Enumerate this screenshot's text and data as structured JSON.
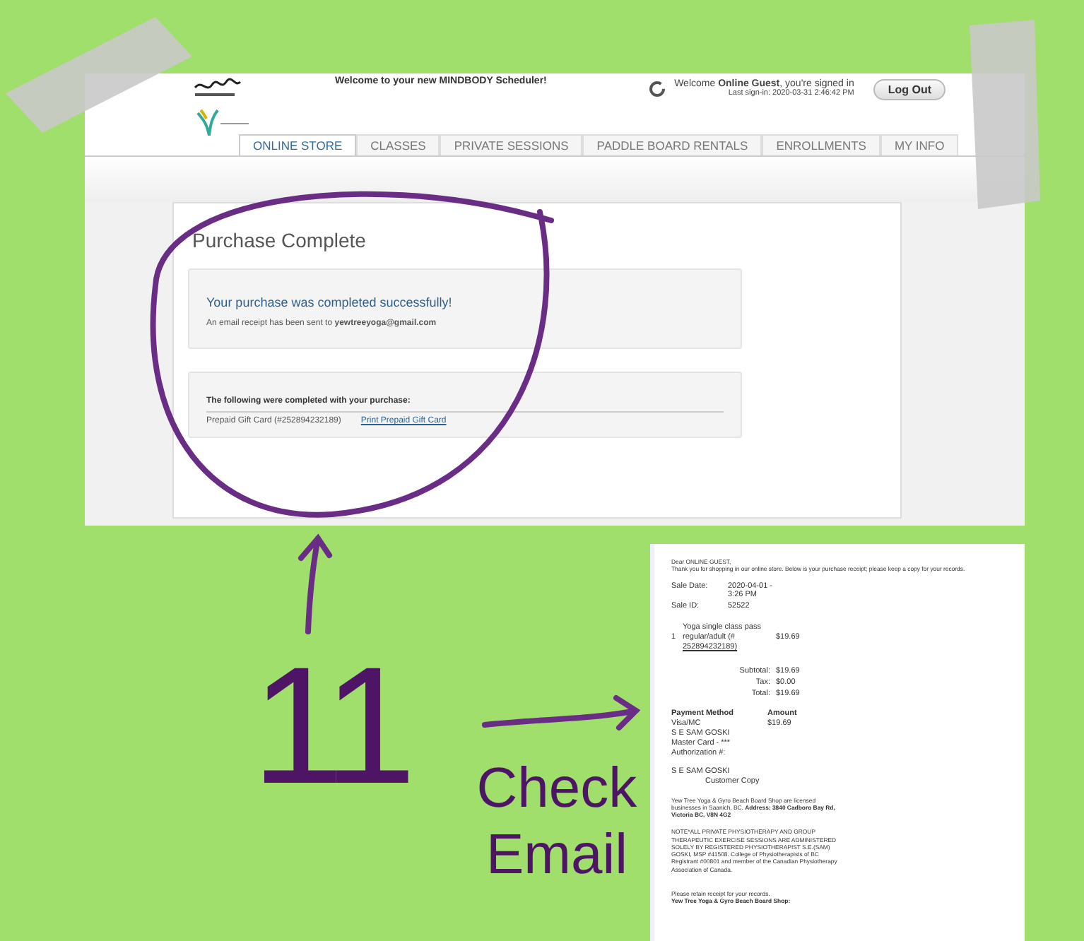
{
  "header": {
    "welcome_banner": "Welcome to your new MINDBODY Scheduler!",
    "greeting": "Welcome **Online Guest**, you're signed in",
    "last_signin": "Last sign-in: 2020-03-31 2:46:42 PM",
    "logout": "Log Out"
  },
  "tabs": [
    {
      "label": "ONLINE STORE",
      "selected": true
    },
    {
      "label": "CLASSES",
      "selected": false
    },
    {
      "label": "PRIVATE SESSIONS",
      "selected": false
    },
    {
      "label": "PADDLE BOARD RENTALS",
      "selected": false
    },
    {
      "label": "ENROLLMENTS",
      "selected": false
    },
    {
      "label": "MY INFO",
      "selected": false
    }
  ],
  "purchase": {
    "title": "Purchase Complete",
    "success": "Your purchase was completed successfully!",
    "receipt_note": "An email receipt has been sent to **yewtreeyoga@gmail.com**",
    "completed_heading": "The following were completed with your purchase:",
    "item": "Prepaid Gift Card (#252894232189)",
    "item_link": "Print Prepaid Gift Card"
  },
  "receipt": {
    "greeting": "Dear ONLINE GUEST,",
    "intro": "Thank you for shopping in our online store. Below is your purchase receipt; please keep a copy for your records.",
    "sale": [
      {
        "label": "Sale Date:",
        "value": "2020-04-01 - 3:26 PM"
      },
      {
        "label": "Sale ID:",
        "value": "52522"
      }
    ],
    "item": {
      "qty": "1",
      "name": "Yoga single class pass regular/adult (#",
      "code": "252894232189)",
      "price": "$19.69"
    },
    "totals": [
      {
        "label": "Subtotal:",
        "value": "$19.69"
      },
      {
        "label": "Tax:",
        "value": "$0.00"
      },
      {
        "label": "Total:",
        "value": "$19.69"
      }
    ],
    "payment": {
      "method_header": "Payment Method",
      "amount_header": "Amount",
      "method": "Visa/MC",
      "amount": "$19.69",
      "lines": [
        "S E SAM GOSKI",
        "Master Card - ***",
        "Authorization #:"
      ]
    },
    "signature": "S E SAM GOSKI",
    "copy": "Customer Copy",
    "business": "Yew Tree Yoga & Gyro Beach Board Shop are licensed businesses in Saanich, BC. **Address: 3840 Cadboro Bay Rd, Victoria BC, V8N 4G2**",
    "note": "NOTE*ALL PRIVATE PHYSIOTHERAPY AND GROUP THERAPEUTIC EXERCISE SESSIONS ARE ADMINISTERED SOLELY BY REGISTERED PHYSIOTHERAPIST S.E.(SAM) GOSKI, MSP #41508. College of Physiotherapists of BC Registrant #00801 and member of the Canadian Physiotherapy Association of Canada.",
    "footer": "Please retain receipt for your records.",
    "footer_shop": "Yew Tree Yoga & Gyro Beach Board Shop:"
  },
  "annotation": {
    "count": "11",
    "caption": "Check Email"
  }
}
